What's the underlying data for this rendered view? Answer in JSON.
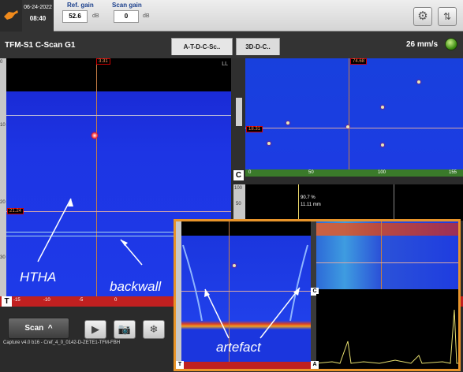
{
  "header": {
    "date": "06-24-2022",
    "time": "08:40",
    "ref_gain_label": "Ref. gain",
    "ref_gain_value": "52.6",
    "ref_gain_unit": "dB",
    "scan_gain_label": "Scan gain",
    "scan_gain_value": "0",
    "scan_gain_unit": "dB",
    "settings_icon": "gear-icon",
    "sort_icon": "up-down-arrows-icon"
  },
  "title": {
    "page_title": "TFM-S1 C-Scan G1",
    "tabs": [
      "A-T-D-C-Sc..",
      "3D-D-C.."
    ],
    "active_tab": 0,
    "speed": "26 mm/s"
  },
  "cscan": {
    "corner_label": "LL",
    "cursor_x_tag": "3.31",
    "cursor_y_tag": "21.24",
    "vscale_ticks": [
      "0",
      "10",
      "20",
      "30",
      "33.3"
    ],
    "hscale_ticks": [
      "-15",
      "-10",
      "-5",
      "0",
      "5",
      "10",
      "15"
    ],
    "bottom_badge": "T",
    "annotations": [
      "HTHA",
      "backwall"
    ]
  },
  "right_top": {
    "cursor_x_tag": "74.68",
    "cursor_y_tag": "18.31",
    "badge": "C",
    "hscale_ticks": [
      "0",
      "50",
      "100",
      "155"
    ]
  },
  "right_mid": {
    "vscale_ticks": [
      "100",
      "50"
    ],
    "amplitude": "90.7 %",
    "depth": "11.11 mm"
  },
  "inset": {
    "annotation": "artefact",
    "badges": [
      "T",
      "C",
      "A"
    ]
  },
  "bottom": {
    "scan_button": "Scan",
    "scan_menu_icon": "caret-up-icon",
    "play_icon": "play-icon",
    "camera_icon": "camera-icon",
    "freeze_icon": "snowflake-icon",
    "caption": "Capture v4.0 b16 - Cref_4_0_0142-D-ZETE1-TFM-FBH"
  }
}
